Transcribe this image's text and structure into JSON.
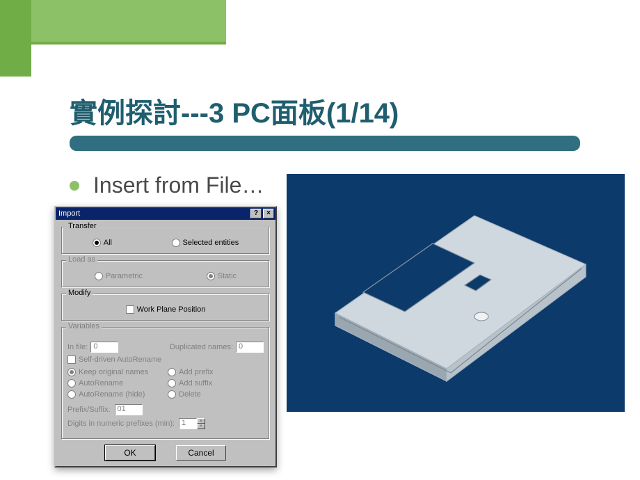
{
  "slide": {
    "title": "實例探討---3  PC面板(1/14)",
    "bullet": "Insert from File…"
  },
  "dialog": {
    "title": "Import",
    "help_glyph": "?",
    "close_glyph": "×",
    "transfer": {
      "legend": "Transfer",
      "all": "All",
      "selected": "Selected entities",
      "value": "all"
    },
    "loadas": {
      "legend": "Load as",
      "parametric": "Parametric",
      "static": "Static",
      "value": "static"
    },
    "modify": {
      "legend": "Modify",
      "workplane": "Work Plane Position",
      "workplane_checked": false
    },
    "variables": {
      "legend": "Variables",
      "infile_label": "In file:",
      "infile_value": "0",
      "dup_label": "Duplicated names:",
      "dup_value": "0",
      "selfdriven": "Self-driven AutoRename",
      "selfdriven_checked": false,
      "keep": "Keep original names",
      "autorename": "AutoRename",
      "autorename_hide": "AutoRename (hide)",
      "addprefix": "Add prefix",
      "addsuffix": "Add suffix",
      "delete": "Delete",
      "name_mode": "keep",
      "suffix_label": "Prefix/Suffix:",
      "suffix_value": "01",
      "digits_label": "Digits in numeric prefixes (min):",
      "digits_value": "1"
    },
    "ok": "OK",
    "cancel": "Cancel"
  },
  "render": {
    "desc": "3D model of PC front panel (sheet metal) on dark blue CAD viewport"
  }
}
